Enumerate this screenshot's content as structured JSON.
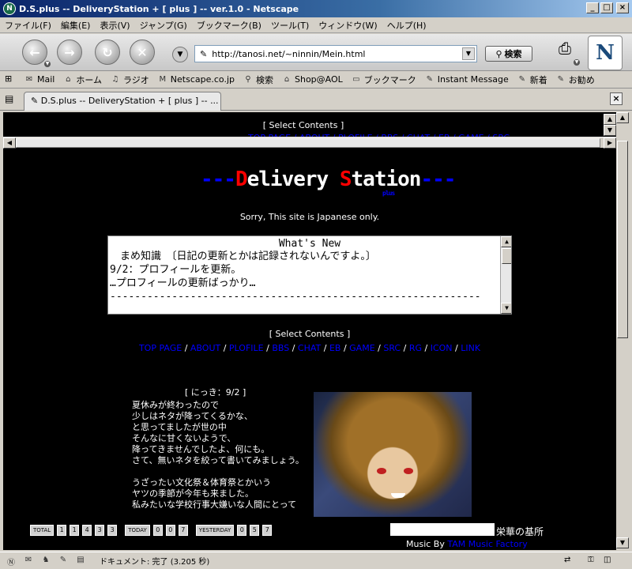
{
  "window": {
    "title": "D.S.plus -- DeliveryStation + [ plus ] -- ver.1.0 - Netscape"
  },
  "menu": [
    "ファイル(F)",
    "編集(E)",
    "表示(V)",
    "ジャンプ(G)",
    "ブックマーク(B)",
    "ツール(T)",
    "ウィンドウ(W)",
    "ヘルプ(H)"
  ],
  "navbar": {
    "url": "http://tanosi.net/~ninnin/Mein.html",
    "search_label": "検索"
  },
  "personal_toolbar": [
    "Mail",
    "ホーム",
    "ラジオ",
    "Netscape.co.jp",
    "検索",
    "Shop@AOL",
    "ブックマーク",
    "Instant Message",
    "新着",
    "お勧め"
  ],
  "tab": {
    "label": "D.S.plus -- DeliveryStation + [ plus ] -- ..."
  },
  "top_frame": {
    "select_label": "[ Select Contents ]",
    "links": "TOP PAGE / ABOUT / PLOFILE / BBS / CHAT / EB / GAME / SRC"
  },
  "logo": {
    "dash_left": "---",
    "d": "D",
    "elivery": "elivery ",
    "s": "S",
    "tation": "tation",
    "dash_right": "---",
    "plus": "plus"
  },
  "sorry": "Sorry, This site is Japanese only.",
  "whats_new": {
    "title": "What's New",
    "lines": [
      "　まめ知識　〔日記の更新とかは記録されないんですよ。〕",
      "9/2：プロフィールを更新。",
      "…プロフィールの更新ばっかり…",
      "------------------------------------------------------------"
    ]
  },
  "select_contents": "[ Select Contents ]",
  "nav_links": [
    "TOP PAGE",
    "ABOUT",
    "PLOFILE",
    "BBS",
    "CHAT",
    "EB",
    "GAME",
    "SRC",
    "RG",
    "ICON",
    "LINK"
  ],
  "diary": {
    "heading": "[ にっき：9/2 ]",
    "lines": [
      "夏休みが終わったので",
      "少しはネタが降ってくるかな、",
      "と思ってましたが世の中",
      "そんなに甘くないようで、",
      "降ってきませんでしたよ、何にも。",
      "さて、無いネタを絞って書いてみましょう。",
      "",
      "うざったい文化祭＆体育祭とかいう",
      "ヤツの季節が今年も来ました。",
      "私みたいな学校行事大嫌いな人間にとって"
    ]
  },
  "counter": {
    "total_label": "TOTAL",
    "total": [
      "1",
      "1",
      "4",
      "3",
      "3"
    ],
    "today_label": "TODAY",
    "today": [
      "0",
      "0",
      "7"
    ],
    "yesterday_label": "YESTERDAY",
    "yesterday": [
      "0",
      "5",
      "7"
    ]
  },
  "music": {
    "title": "栄華の基所",
    "by_label": "Music By ",
    "by_name": "TAM Music Factory"
  },
  "status": {
    "text": "ドキュメント: 完了 (3.205 秒)"
  },
  "colors": {
    "bg": "#000000",
    "link": "#0000ff",
    "logo_red": "#ff0000"
  }
}
